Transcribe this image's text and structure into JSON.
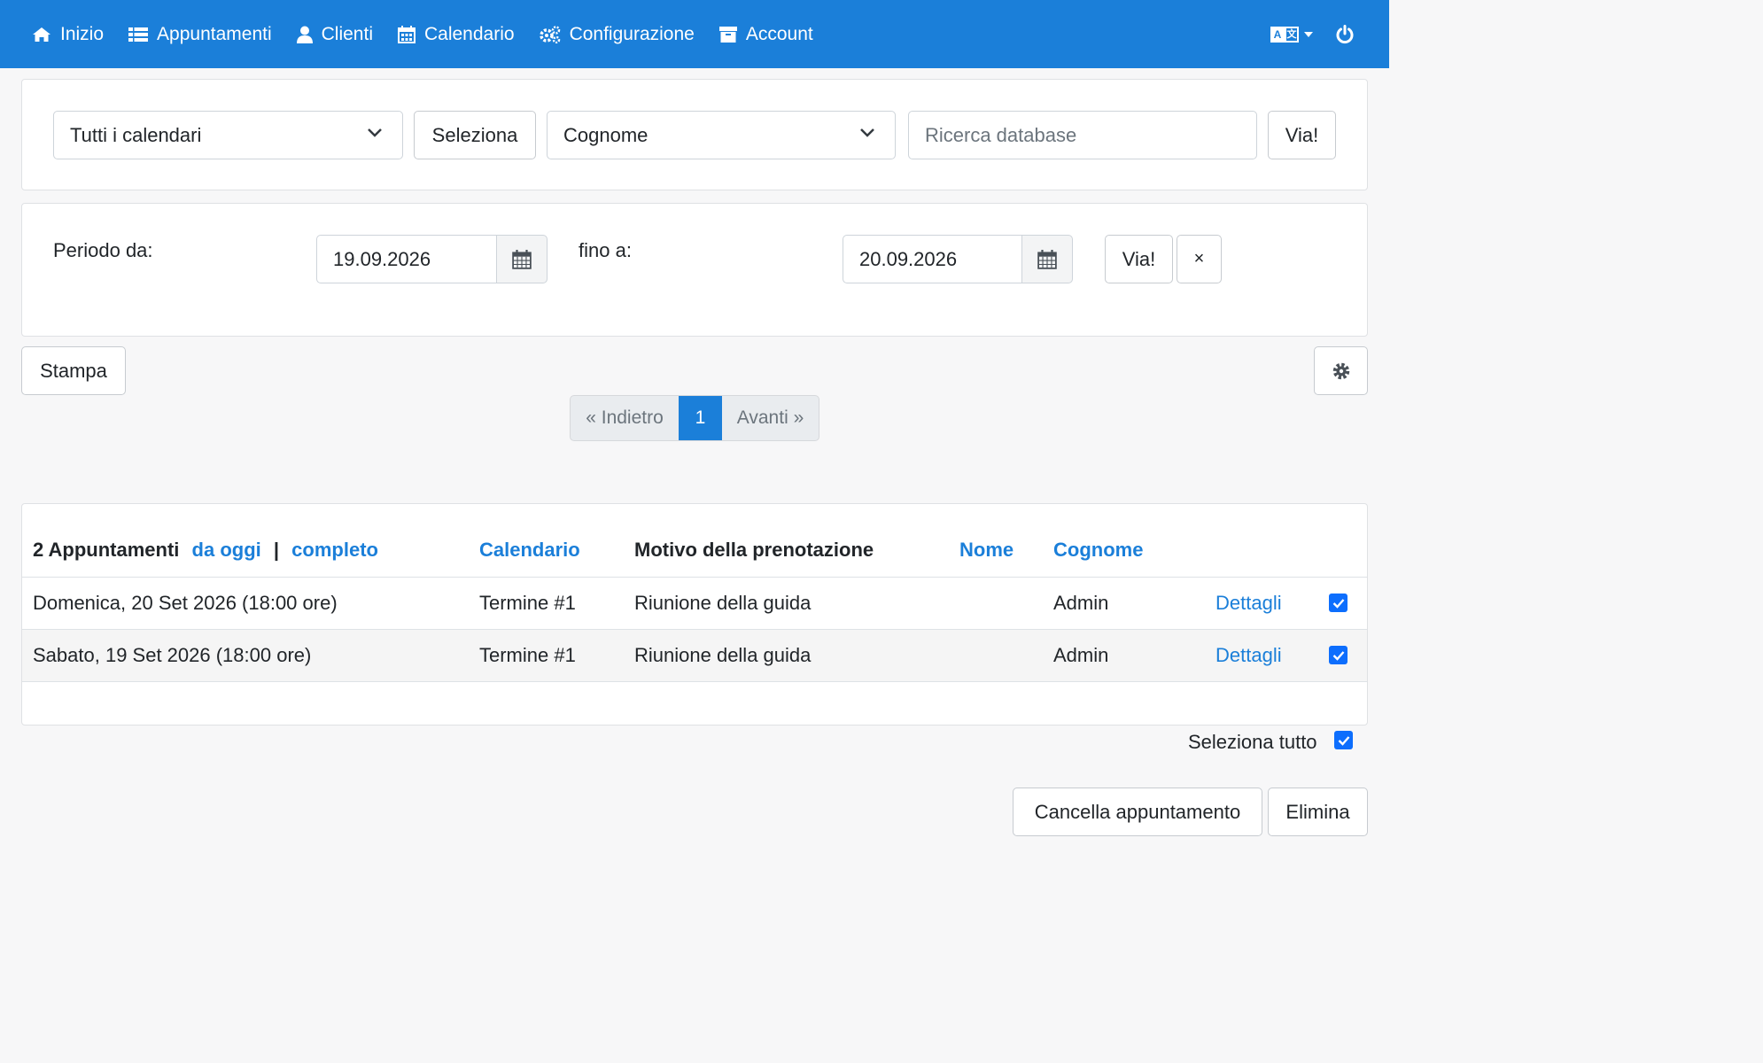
{
  "nav": {
    "items": [
      {
        "label": "Inizio",
        "icon": "home-icon"
      },
      {
        "label": "Appuntamenti",
        "icon": "list-icon"
      },
      {
        "label": "Clienti",
        "icon": "user-icon"
      },
      {
        "label": "Calendario",
        "icon": "calendar-icon"
      },
      {
        "label": "Configurazione",
        "icon": "gears-icon"
      },
      {
        "label": "Account",
        "icon": "archive-icon"
      }
    ],
    "lang_icon": "language-icon",
    "power_icon": "power-icon"
  },
  "search": {
    "calendar_select": "Tutti i calendari",
    "select_button": "Seleziona",
    "field_select": "Cognome",
    "placeholder": "Ricerca database",
    "go_button": "Via!"
  },
  "period": {
    "from_label": "Periodo da:",
    "from_value": "19.09.2026",
    "to_label": "fino a:",
    "to_value": "20.09.2026",
    "go_button": "Via!",
    "clear_button": "×"
  },
  "toolbar": {
    "print_button": "Stampa",
    "settings_icon": "gear-icon"
  },
  "pagination": {
    "prev": "« Indietro",
    "current": "1",
    "next": "Avanti »"
  },
  "table": {
    "count_label": "2 Appuntamenti",
    "from_today_link": "da oggi",
    "separator": "|",
    "complete_link": "completo",
    "columns": {
      "calendar": "Calendario",
      "reason": "Motivo della prenotazione",
      "name": "Nome",
      "surname": "Cognome"
    },
    "rows": [
      {
        "date": "Domenica, 20 Set 2026 (18:00 ore)",
        "calendar": "Termine #1",
        "reason": "Riunione della guida",
        "name": "",
        "surname": "Admin",
        "details": "Dettagli",
        "checked": true
      },
      {
        "date": "Sabato, 19 Set 2026 (18:00 ore)",
        "calendar": "Termine #1",
        "reason": "Riunione della guida",
        "name": "",
        "surname": "Admin",
        "details": "Dettagli",
        "checked": true
      }
    ]
  },
  "footer": {
    "select_all": "Seleziona tutto",
    "cancel_button": "Cancella appuntamento",
    "delete_button": "Elimina"
  },
  "colors": {
    "primary": "#1b7fd9",
    "checkbox": "#0d6efd"
  }
}
